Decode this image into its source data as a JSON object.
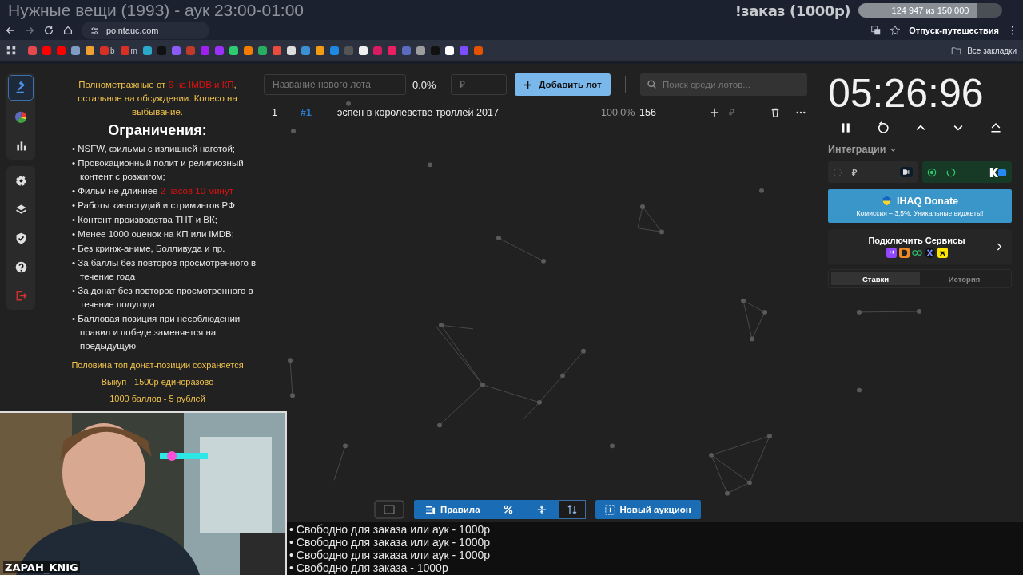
{
  "stream_overlay": {
    "title": "Нужные вещи (1993) - аук 23:00-01:00",
    "goal_label": "!заказ (1000р)",
    "goal": {
      "level": 0.83,
      "reading": "124 947  из 150 000"
    },
    "goal_caption": "Отпуск-путешествия",
    "streamer_name": "ZAPAH_KNIG",
    "queue": [
      "• Свободно для заказа или аук - 1000р",
      "• Свободно для заказа или аук - 1000р",
      "• Свободно для заказа или аук - 1000р",
      "• Свободно для заказа - 1000р"
    ]
  },
  "browser": {
    "address": "pointauc.com",
    "all_bookmarks": "Все закладки",
    "bookmarks": [
      {
        "color": "#e5484d"
      },
      {
        "color": "#ff0000"
      },
      {
        "color": "#ff0000"
      },
      {
        "color": "#7f9cc4"
      },
      {
        "color": "#f0a030"
      },
      {
        "color": "#d93025",
        "label": "b"
      },
      {
        "color": "#d93025",
        "label": "m"
      },
      {
        "color": "#2aa7c9"
      },
      {
        "color": "#111111"
      },
      {
        "color": "#8a5cf5"
      },
      {
        "color": "#c0392b"
      },
      {
        "color": "#a020f0"
      },
      {
        "color": "#9b30ff"
      },
      {
        "color": "#2ecc71"
      },
      {
        "color": "#f57c00"
      },
      {
        "color": "#27ae60"
      },
      {
        "color": "#e74c3c"
      },
      {
        "color": "#dddddd"
      },
      {
        "color": "#3d8fd6"
      },
      {
        "color": "#f39c12"
      },
      {
        "color": "#1e88e5"
      },
      {
        "color": "#555555"
      },
      {
        "color": "#f0f0f0"
      },
      {
        "color": "#d81b60"
      },
      {
        "color": "#e91e63"
      },
      {
        "color": "#5c6bc0"
      },
      {
        "color": "#9e9e9e"
      },
      {
        "color": "#111111"
      },
      {
        "color": "#ffffff"
      },
      {
        "color": "#7c4dff"
      },
      {
        "color": "#e65100"
      }
    ]
  },
  "sidebar": {
    "groups": [
      [
        {
          "kind": "gavel",
          "selected": true
        },
        {
          "kind": "pie",
          "selected": false
        },
        {
          "kind": "bars",
          "selected": false
        }
      ],
      [
        {
          "kind": "gear",
          "selected": false
        },
        {
          "kind": "layers",
          "selected": false
        },
        {
          "kind": "shield",
          "selected": false
        },
        {
          "kind": "help",
          "selected": false
        },
        {
          "kind": "logout",
          "selected": false
        }
      ]
    ]
  },
  "rules": {
    "intro": {
      "text": "Полнометражные от ",
      "highlight": "6 на IMDB и КП",
      "after": ", остальное на обсуждении. Колесо на выбывание."
    },
    "heading": "Ограничения:",
    "items": [
      {
        "text": "• NSFW, фильмы с излишней наготой;"
      },
      {
        "text": "• Провокационный полит и религиозный контент с розжигом;"
      },
      {
        "text": "• Фильм не длиннее ",
        "highlight": "2 часов 10 минут"
      },
      {
        "text": "• Работы киностудий и стримингов РФ"
      },
      {
        "text": "• Контент производства ТНТ и ВК;"
      },
      {
        "text": "• Менее 1000 оценок на КП или iMDB;"
      },
      {
        "text": "• Без кринж-аниме, Болливуда и пр."
      },
      {
        "text": "• За баллы без повторов просмотренного в течение года"
      },
      {
        "text": "• За донат без повторов просмотренного в течение полугода"
      },
      {
        "text": "• Балловая позиция при несоблюдении правил и победе заменяется на предыдущую"
      }
    ],
    "footer": [
      "Половина топ донат-позиции сохраняется",
      "Выкуп - 1500р единоразово",
      "1000 баллов - 5 рублей"
    ]
  },
  "new_lot": {
    "name_placeholder": "Название нового лота",
    "percent": "0.0%",
    "amount_placeholder": "₽",
    "add_button": "Добавить лот",
    "search_placeholder": "Поиск среди лотов..."
  },
  "lots": [
    {
      "rank": "1",
      "id": "#1",
      "name": "эспен в королевстве троллей 2017",
      "percent": "100.0%",
      "amount": "156",
      "amount_placeholder": "₽"
    }
  ],
  "toolbar": {
    "rules": "Правила",
    "new_auction": "Новый аукцион"
  },
  "timer": "05:26:96",
  "integrations": {
    "title": "Интеграции",
    "cards": [
      {
        "kind": "currency",
        "symbol": "₽",
        "on": false
      },
      {
        "kind": "vk",
        "on": true
      }
    ],
    "promo": {
      "title": "IHAQ Donate",
      "subtitle": "Комиссия – 3,5%. Уникальные виджеты!"
    },
    "connect": "Подключить Сервисы",
    "tabs": [
      {
        "label": "Ставки",
        "selected": true
      },
      {
        "label": "История",
        "selected": false
      }
    ]
  }
}
